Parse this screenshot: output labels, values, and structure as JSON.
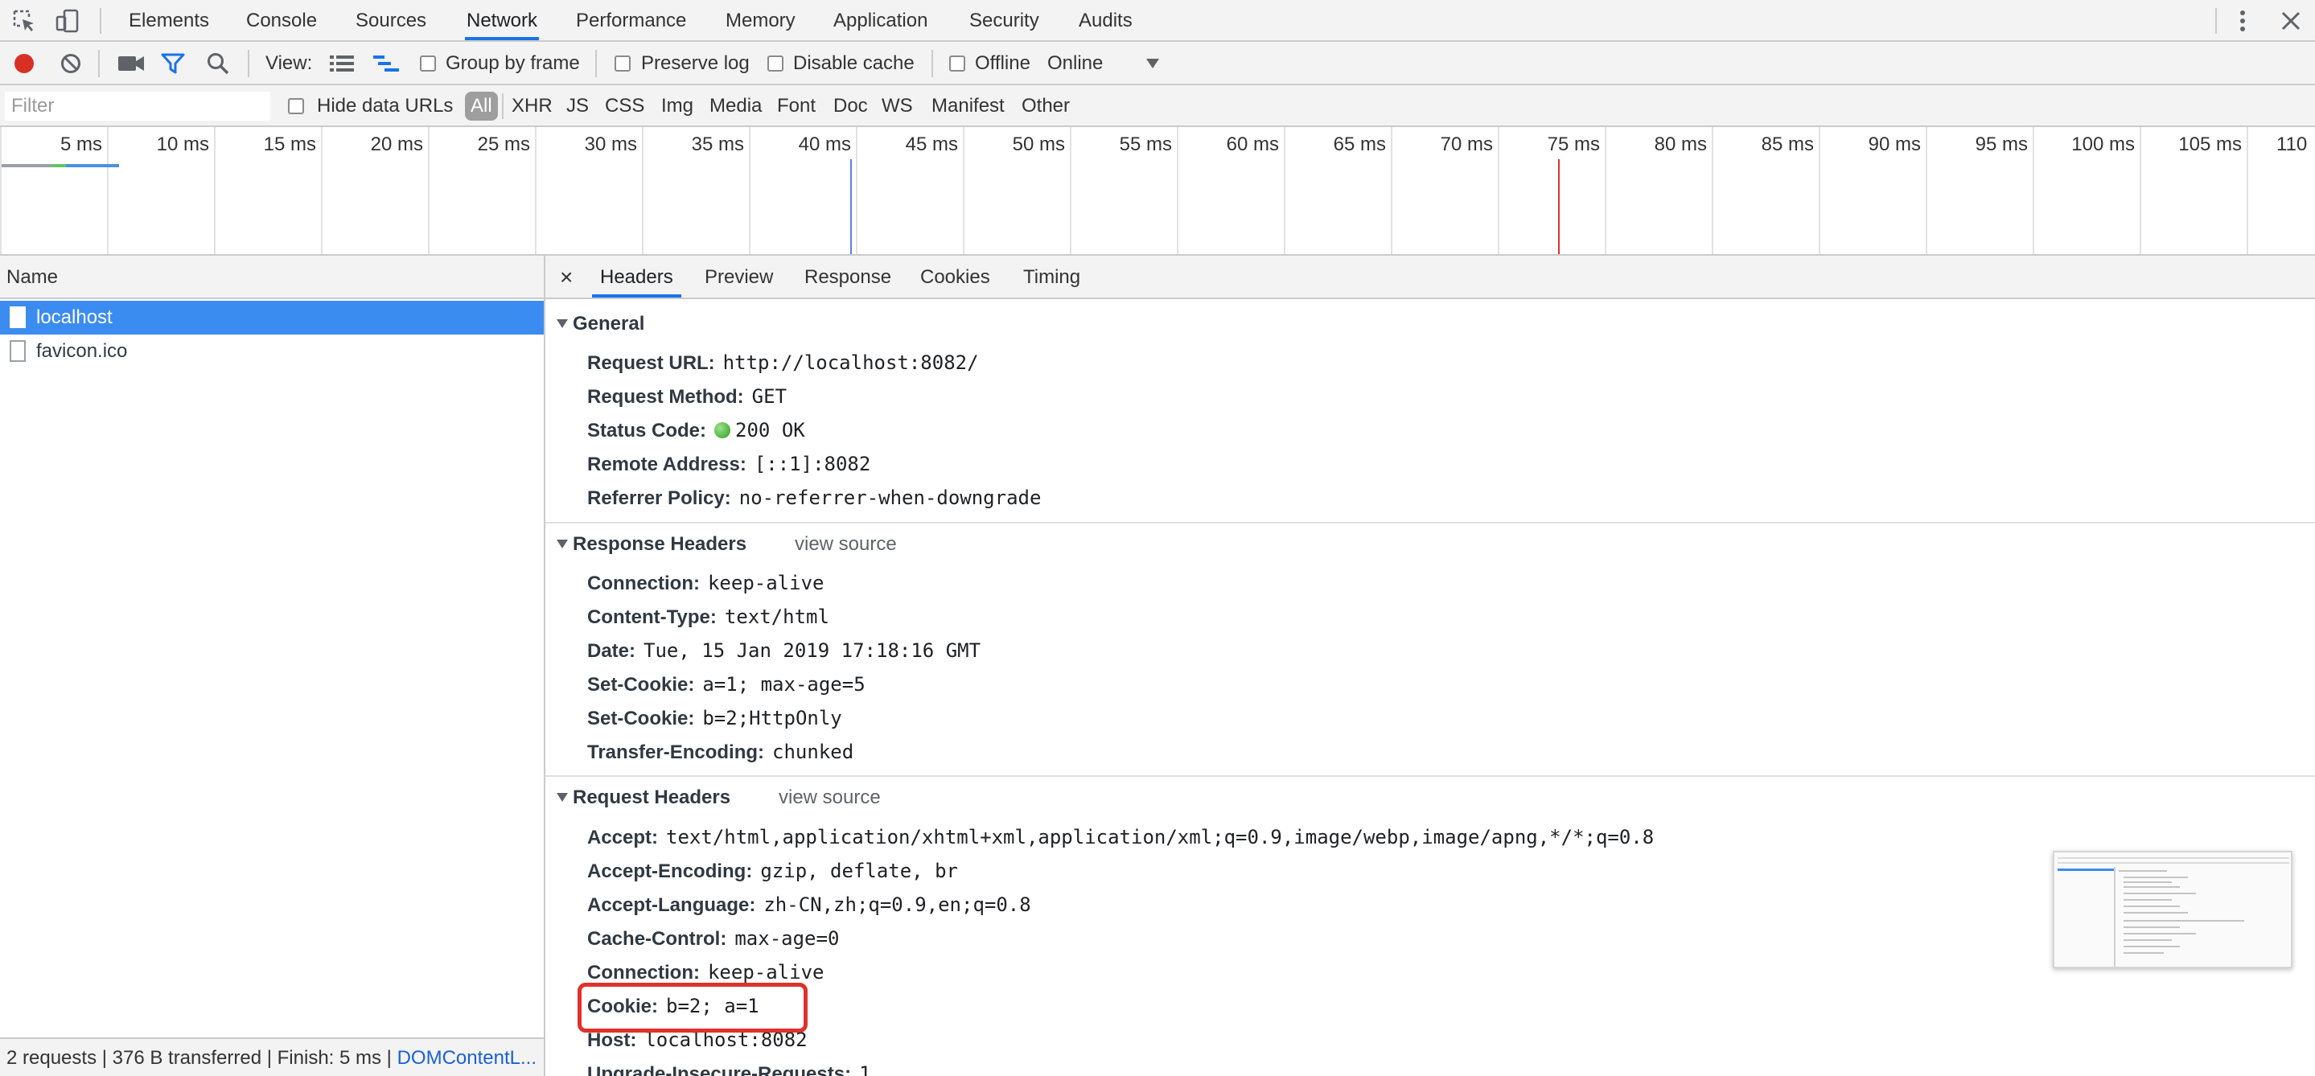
{
  "panel_tabs": [
    "Elements",
    "Console",
    "Sources",
    "Network",
    "Performance",
    "Memory",
    "Application",
    "Security",
    "Audits"
  ],
  "active_panel": "Network",
  "toolbar": {
    "view_label": "View:",
    "group_by_frame": "Group by frame",
    "preserve_log": "Preserve log",
    "disable_cache": "Disable cache",
    "offline": "Offline",
    "throttle_value": "Online",
    "recording_color": "#d93025"
  },
  "filter": {
    "placeholder": "Filter",
    "hide_data_urls": "Hide data URLs",
    "types": [
      "All",
      "XHR",
      "JS",
      "CSS",
      "Img",
      "Media",
      "Font",
      "Doc",
      "WS",
      "Manifest",
      "Other"
    ],
    "active_type": "All"
  },
  "overview": {
    "ticks": [
      "5 ms",
      "10 ms",
      "15 ms",
      "20 ms",
      "25 ms",
      "30 ms",
      "35 ms",
      "40 ms",
      "45 ms",
      "50 ms",
      "55 ms",
      "60 ms",
      "65 ms",
      "70 ms",
      "75 ms",
      "80 ms",
      "85 ms",
      "90 ms",
      "95 ms",
      "100 ms",
      "105 ms",
      "110"
    ],
    "dom_content_loaded_color": "#5b7fe6",
    "load_color": "#e0312c"
  },
  "requests": {
    "column_header": "Name",
    "items": [
      {
        "name": "localhost",
        "selected": true
      },
      {
        "name": "favicon.ico",
        "selected": false
      }
    ]
  },
  "summary": {
    "text": "2 requests | 376 B transferred | Finish: 5 ms | ",
    "link": "DOMContentL..."
  },
  "details": {
    "close_glyph": "×",
    "tabs": [
      "Headers",
      "Preview",
      "Response",
      "Cookies",
      "Timing"
    ],
    "active_tab": "Headers",
    "general": {
      "title": "General",
      "rows": [
        {
          "name": "Request URL:",
          "value": "http://localhost:8082/"
        },
        {
          "name": "Request Method:",
          "value": "GET"
        },
        {
          "name": "Status Code:",
          "value": "200 OK"
        },
        {
          "name": "Remote Address:",
          "value": "[::1]:8082"
        },
        {
          "name": "Referrer Policy:",
          "value": "no-referrer-when-downgrade"
        }
      ]
    },
    "response_headers": {
      "title": "Response Headers",
      "view_source": "view source",
      "rows": [
        {
          "name": "Connection:",
          "value": "keep-alive"
        },
        {
          "name": "Content-Type:",
          "value": "text/html"
        },
        {
          "name": "Date:",
          "value": "Tue, 15 Jan 2019 17:18:16 GMT"
        },
        {
          "name": "Set-Cookie:",
          "value": "a=1; max-age=5"
        },
        {
          "name": "Set-Cookie:",
          "value": "b=2;HttpOnly"
        },
        {
          "name": "Transfer-Encoding:",
          "value": "chunked"
        }
      ]
    },
    "request_headers": {
      "title": "Request Headers",
      "view_source": "view source",
      "rows": [
        {
          "name": "Accept:",
          "value": "text/html,application/xhtml+xml,application/xml;q=0.9,image/webp,image/apng,*/*;q=0.8"
        },
        {
          "name": "Accept-Encoding:",
          "value": "gzip, deflate, br"
        },
        {
          "name": "Accept-Language:",
          "value": "zh-CN,zh;q=0.9,en;q=0.8"
        },
        {
          "name": "Cache-Control:",
          "value": "max-age=0"
        },
        {
          "name": "Connection:",
          "value": "keep-alive"
        },
        {
          "name": "Cookie:",
          "value": "b=2; a=1"
        },
        {
          "name": "Host:",
          "value": "localhost:8082"
        },
        {
          "name": "Upgrade-Insecure-Requests:",
          "value": "1"
        }
      ]
    },
    "highlight_color": "#e0312c"
  }
}
